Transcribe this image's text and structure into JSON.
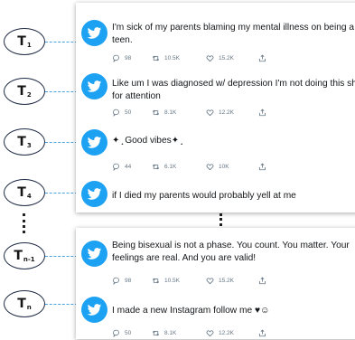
{
  "timeline": {
    "nodes": [
      {
        "main": "T",
        "sub": "1"
      },
      {
        "main": "T",
        "sub": "2"
      },
      {
        "main": "T",
        "sub": "3"
      },
      {
        "main": "T",
        "sub": "4"
      },
      {
        "main": "T",
        "sub": "n-1"
      },
      {
        "main": "T",
        "sub": "n"
      }
    ]
  },
  "tweets": [
    {
      "text": "I'm sick of my parents blaming my mental illness on being a teen.",
      "replies": "98",
      "retweets": "10.5K",
      "likes": "15.2K"
    },
    {
      "text": "Like um I was diagnosed w/ depression I'm not doing this shit for attention",
      "replies": "50",
      "retweets": "8.1K",
      "likes": "12.2K"
    },
    {
      "text": "✦ ̟ Good vibes✦ ̟",
      "replies": "44",
      "retweets": "6.1K",
      "likes": "10K"
    },
    {
      "text": "if I died my parents would probably yell at me"
    },
    {
      "text": "Being bisexual is not a phase. You count. You matter. Your feelings are real. And you are valid!",
      "replies": "98",
      "retweets": "10.5K",
      "likes": "15.2K"
    },
    {
      "text": "I made a new Instagram follow me ♥☺",
      "replies": "50",
      "retweets": "8.1K",
      "likes": "12.2K"
    }
  ],
  "icons": {
    "avatar": "twitter-bird-icon",
    "reply": "reply-icon",
    "retweet": "retweet-icon",
    "like": "heart-icon",
    "share": "share-icon"
  },
  "colors": {
    "twitter_blue": "#1da1f2",
    "connector": "#4aa3df",
    "text": "#14171a",
    "muted": "#657786"
  }
}
